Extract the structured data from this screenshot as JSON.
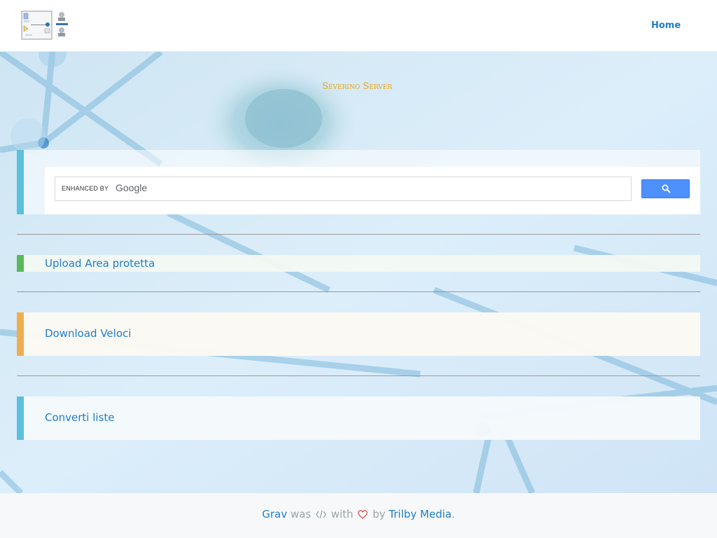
{
  "header": {
    "nav": {
      "home_label": "Home"
    }
  },
  "site": {
    "title": "Severino Server"
  },
  "search": {
    "enhanced_label": "ENHANCED BY",
    "brand_label": "Google",
    "value": "",
    "placeholder": ""
  },
  "links": {
    "upload": "Upload Area protetta",
    "download": "Download Veloci",
    "converti": "Converti liste"
  },
  "footer": {
    "grav": "Grav",
    "was": "was",
    "with": "with",
    "by": "by",
    "trilby": "Trilby Media",
    "period": "."
  },
  "colors": {
    "accent_link": "#1f7dca",
    "title_gold": "#e6a515",
    "info": "#5bc0de",
    "success": "#5cb85c",
    "warning": "#f0ad4e",
    "heart": "#d9534f",
    "search_button": "#4d90fe"
  },
  "icons": {
    "search_button": "magnifier-icon",
    "code": "code-icon",
    "heart": "heart-icon"
  }
}
